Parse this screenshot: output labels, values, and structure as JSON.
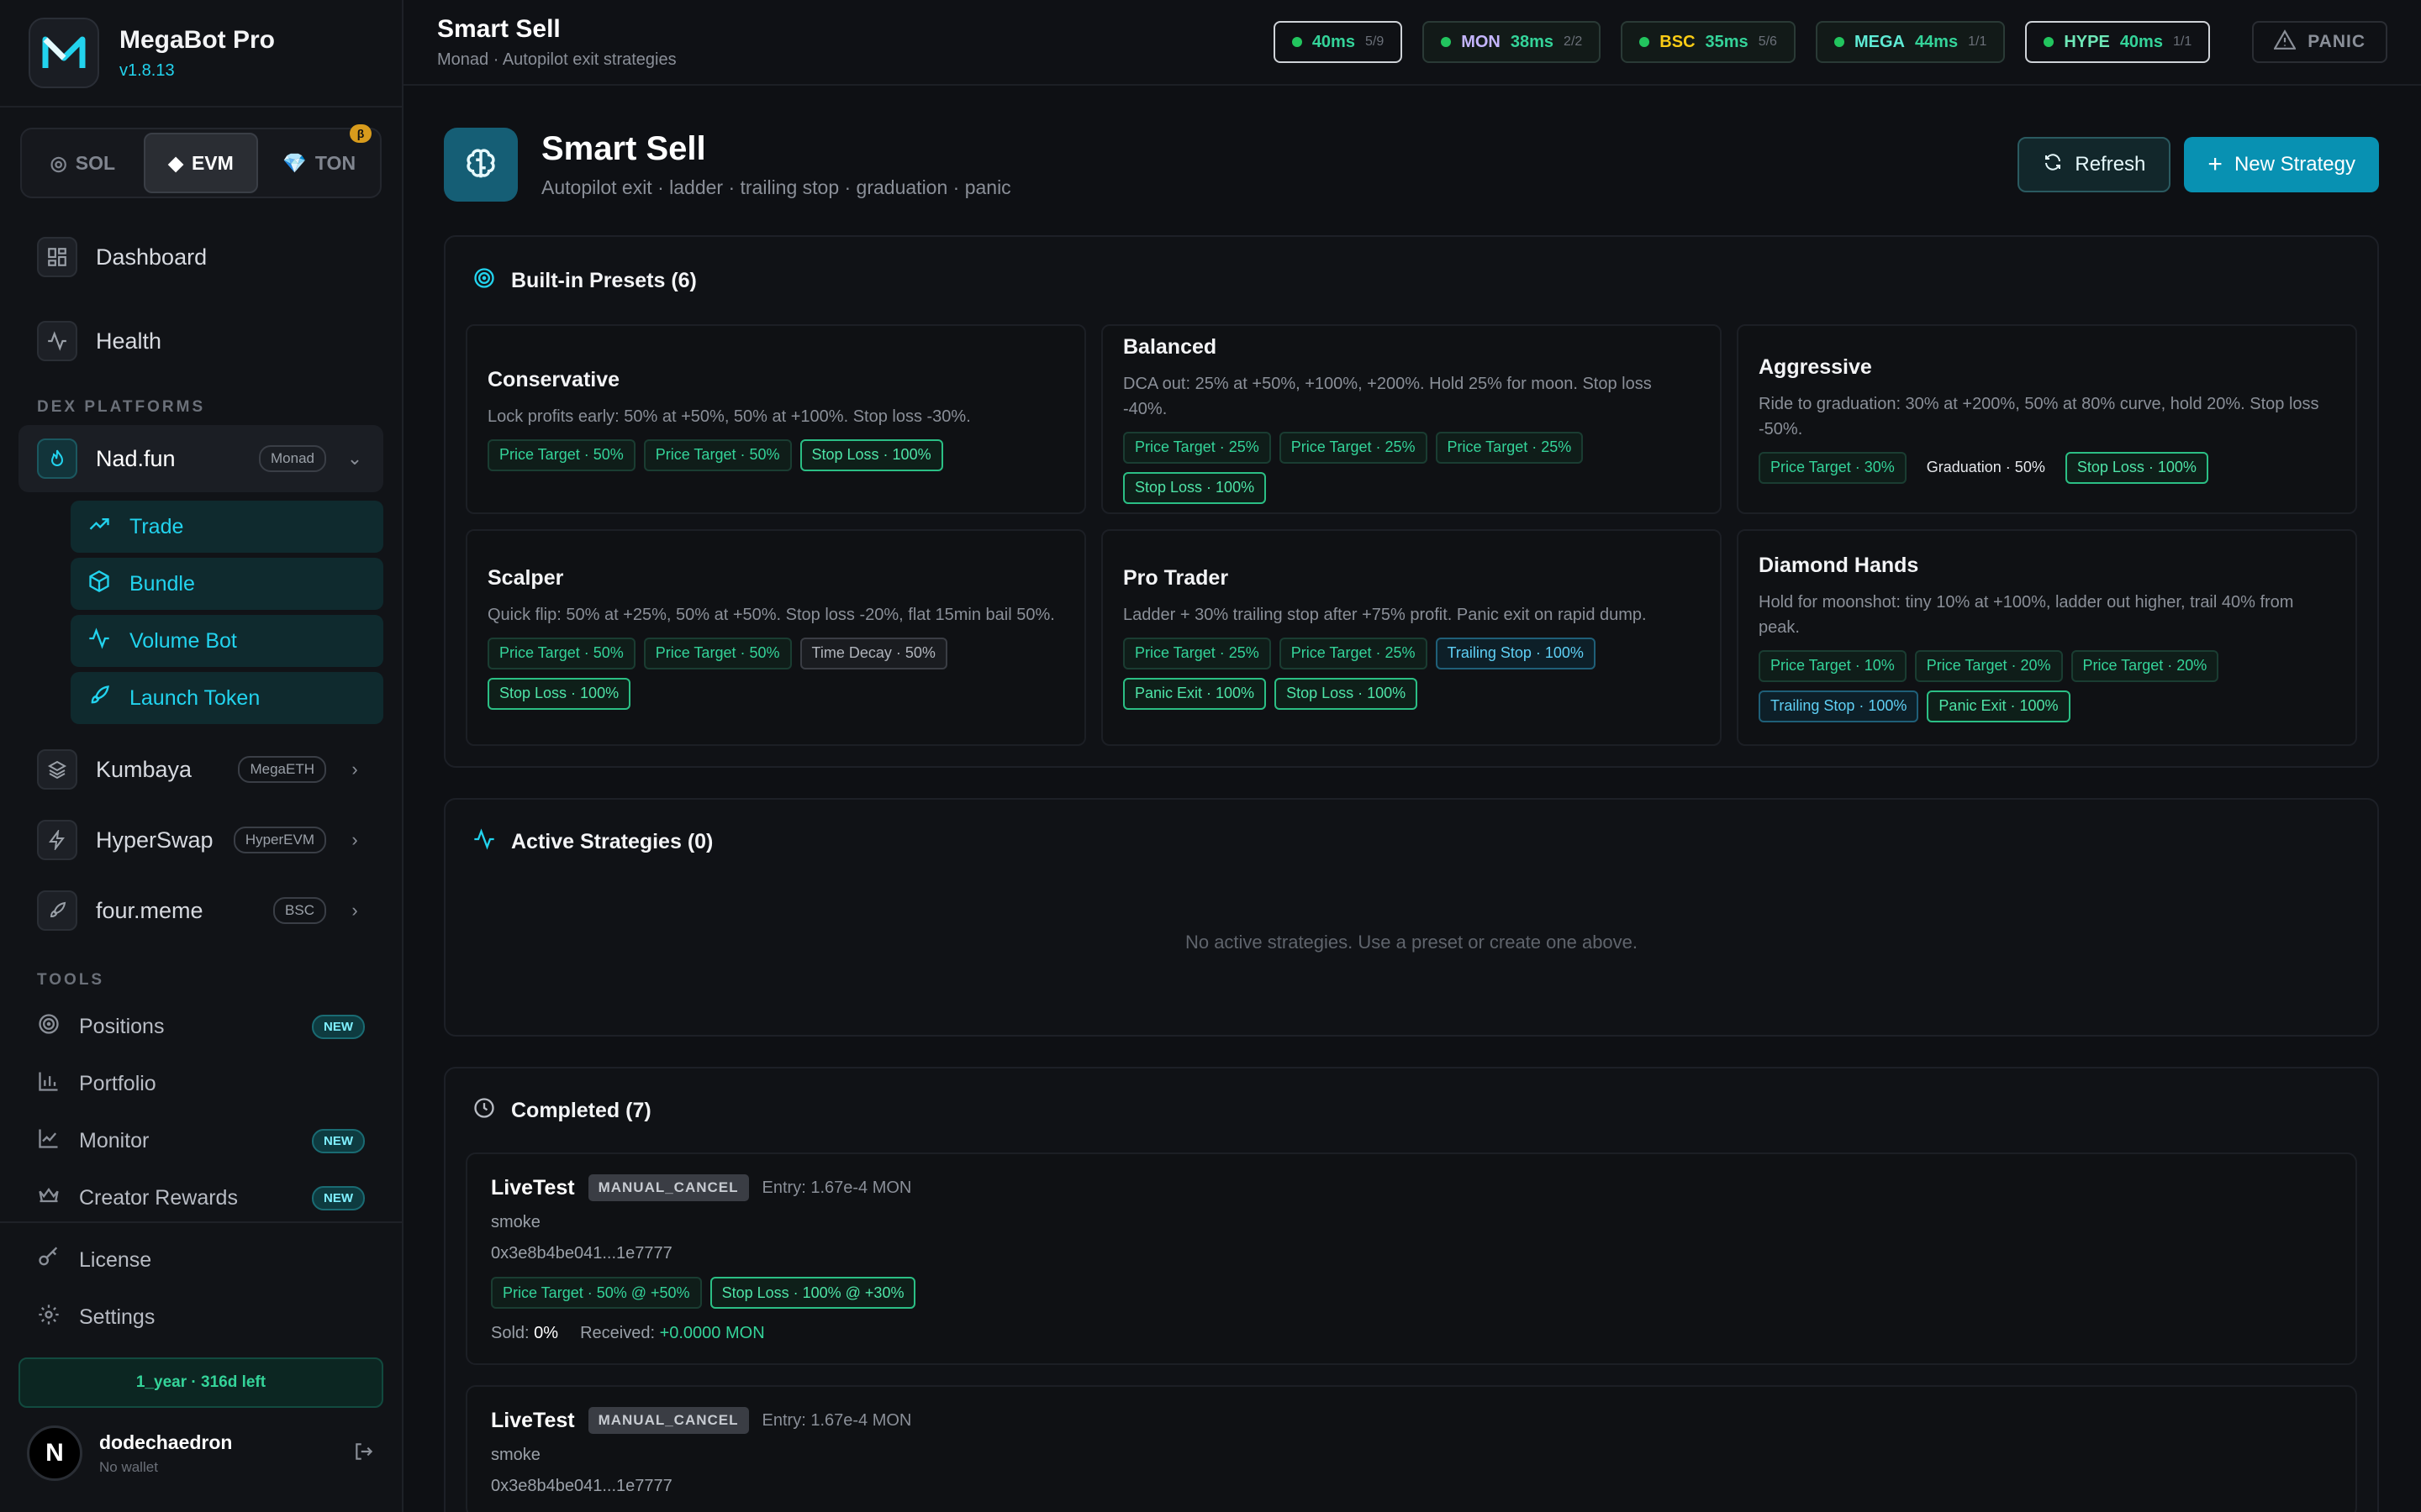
{
  "app": {
    "name": "MegaBot Pro",
    "version": "v1.8.13"
  },
  "chains": [
    {
      "label": "SOL",
      "icon": "sol-icon"
    },
    {
      "label": "EVM",
      "icon": "diamond-icon"
    },
    {
      "label": "TON",
      "icon": "gem-icon"
    }
  ],
  "chain_beta": "β",
  "nav": {
    "dashboard": "Dashboard",
    "health": "Health"
  },
  "sections": {
    "dex": "DEX PLATFORMS",
    "tools": "TOOLS"
  },
  "dex": [
    {
      "label": "Nad.fun",
      "tag": "Monad"
    },
    {
      "label": "Kumbaya",
      "tag": "MegaETH"
    },
    {
      "label": "HyperSwap",
      "tag": "HyperEVM"
    },
    {
      "label": "four.meme",
      "tag": "BSC"
    }
  ],
  "nadfun_sub": [
    "Trade",
    "Bundle",
    "Volume Bot",
    "Launch Token"
  ],
  "tools": [
    {
      "label": "Positions",
      "badge": "NEW"
    },
    {
      "label": "Portfolio",
      "badge": ""
    },
    {
      "label": "Monitor",
      "badge": "NEW"
    },
    {
      "label": "Creator Rewards",
      "badge": "NEW"
    }
  ],
  "bottom": {
    "license": "License",
    "settings": "Settings",
    "plan": "1_year · 316d left",
    "user": "dodechaedron",
    "wallet": "No wallet",
    "avatar": "N"
  },
  "topbar": {
    "title": "Smart Sell",
    "subtitle": "Monad · Autopilot exit strategies",
    "panic": "PANIC"
  },
  "pills": [
    {
      "chain": "",
      "ms": "40ms",
      "count": "5/9"
    },
    {
      "chain": "MON",
      "ms": "38ms",
      "count": "2/2"
    },
    {
      "chain": "BSC",
      "ms": "35ms",
      "count": "5/6"
    },
    {
      "chain": "MEGA",
      "ms": "44ms",
      "count": "1/1"
    },
    {
      "chain": "HYPE",
      "ms": "40ms",
      "count": "1/1"
    }
  ],
  "colors": {
    "accent": "#0891b2",
    "green": "#34d399",
    "mon": "#c4b5fd",
    "bsc": "#facc15",
    "mega": "#5eead4",
    "hype": "#6ee7b7"
  },
  "hero": {
    "title": "Smart Sell",
    "subtitle": "Autopilot exit · ladder · trailing stop · graduation · panic",
    "refresh": "Refresh",
    "new": "New Strategy"
  },
  "presets": {
    "title": "Built-in Presets (6)",
    "items": [
      {
        "name": "Conservative",
        "desc": "Lock profits early: 50% at +50%, 50% at +100%. Stop loss -30%.",
        "tags": [
          [
            "Price Target · 50%",
            "pt"
          ],
          [
            "Price Target · 50%",
            "pt"
          ],
          [
            "Stop Loss · 100%",
            "stop"
          ]
        ]
      },
      {
        "name": "Balanced",
        "desc": "DCA out: 25% at +50%, +100%, +200%. Hold 25% for moon. Stop loss -40%.",
        "tags": [
          [
            "Price Target · 25%",
            "pt"
          ],
          [
            "Price Target · 25%",
            "pt"
          ],
          [
            "Price Target · 25%",
            "pt"
          ],
          [
            "Stop Loss · 100%",
            "stop"
          ]
        ]
      },
      {
        "name": "Aggressive",
        "desc": "Ride to graduation: 30% at +200%, 50% at 80% curve, hold 20%. Stop loss -50%.",
        "tags": [
          [
            "Price Target · 30%",
            "pt"
          ],
          [
            "Graduation · 50%",
            "grad"
          ],
          [
            "Stop Loss · 100%",
            "stop"
          ]
        ]
      },
      {
        "name": "Scalper",
        "desc": "Quick flip: 50% at +25%, 50% at +50%. Stop loss -20%, flat 15min bail 50%.",
        "tags": [
          [
            "Price Target · 50%",
            "pt"
          ],
          [
            "Price Target · 50%",
            "pt"
          ],
          [
            "Time Decay · 50%",
            "decay"
          ],
          [
            "Stop Loss · 100%",
            "stop"
          ]
        ]
      },
      {
        "name": "Pro Trader",
        "desc": "Ladder + 30% trailing stop after +75% profit. Panic exit on rapid dump.",
        "tags": [
          [
            "Price Target · 25%",
            "pt"
          ],
          [
            "Price Target · 25%",
            "pt"
          ],
          [
            "Trailing Stop · 100%",
            "trail"
          ],
          [
            "Panic Exit · 100%",
            "stop"
          ],
          [
            "Stop Loss · 100%",
            "stop"
          ]
        ]
      },
      {
        "name": "Diamond Hands",
        "desc": "Hold for moonshot: tiny 10% at +100%, ladder out higher, trail 40% from peak.",
        "tags": [
          [
            "Price Target · 10%",
            "pt"
          ],
          [
            "Price Target · 20%",
            "pt"
          ],
          [
            "Price Target · 20%",
            "pt"
          ],
          [
            "Trailing Stop · 100%",
            "trail"
          ],
          [
            "Panic Exit · 100%",
            "stop"
          ]
        ]
      }
    ]
  },
  "active": {
    "title": "Active Strategies (0)",
    "empty": "No active strategies. Use a preset or create one above."
  },
  "completed": {
    "title": "Completed (7)",
    "items": [
      {
        "name": "LiveTest",
        "badge": "MANUAL_CANCEL",
        "entry": "Entry: 1.67e-4 MON",
        "note": "smoke",
        "addr": "0x3e8b4be041...1e7777",
        "tags": [
          [
            "Price Target · 50% @ +50%",
            "pt"
          ],
          [
            "Stop Loss · 100% @ +30%",
            "stop"
          ]
        ],
        "sold_label": "Sold:",
        "sold": "0%",
        "recv_label": "Received:",
        "recv": "+0.0000 MON"
      },
      {
        "name": "LiveTest",
        "badge": "MANUAL_CANCEL",
        "entry": "Entry: 1.67e-4 MON",
        "note": "smoke",
        "addr": "0x3e8b4be041...1e7777",
        "tags": [],
        "sold_label": "",
        "sold": "",
        "recv_label": "",
        "recv": ""
      }
    ]
  }
}
